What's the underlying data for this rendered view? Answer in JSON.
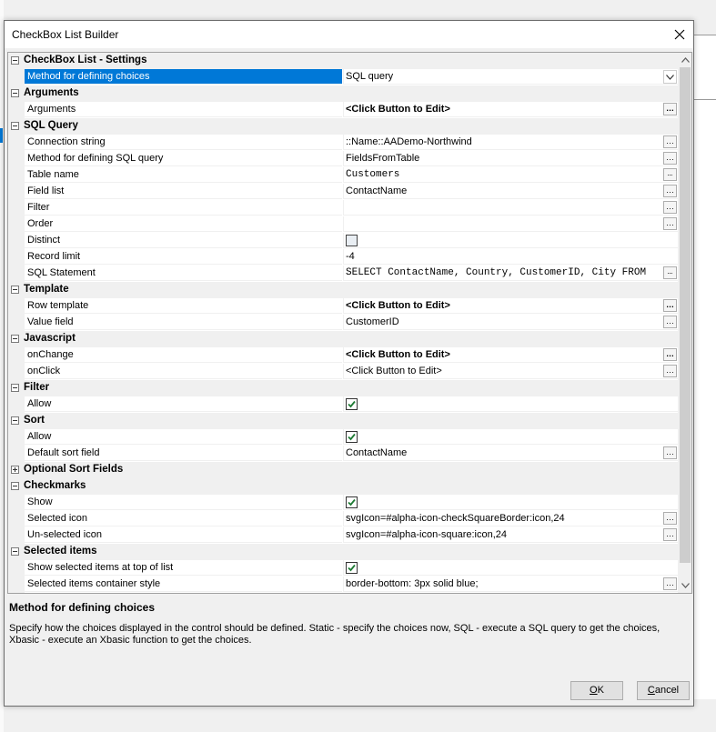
{
  "window": {
    "title": "CheckBox List Builder",
    "close_icon": "close-icon"
  },
  "grid": {
    "rows": [
      {
        "type": "cat",
        "expanded": true,
        "label": "CheckBox List - Settings"
      },
      {
        "type": "prop",
        "name": "Method for defining choices",
        "value": "SQL query",
        "editor": "dropdown",
        "selected": true
      },
      {
        "type": "cat",
        "expanded": true,
        "label": "Arguments"
      },
      {
        "type": "prop",
        "name": "Arguments",
        "value": "<Click Button to Edit>",
        "editor": "ellipsis",
        "bold": true
      },
      {
        "type": "cat",
        "expanded": true,
        "label": "SQL Query"
      },
      {
        "type": "prop",
        "name": "Connection string",
        "value": "::Name::AADemo-Northwind",
        "editor": "ellipsis"
      },
      {
        "type": "prop",
        "name": "Method for defining SQL query",
        "value": "FieldsFromTable",
        "editor": "ellipsis"
      },
      {
        "type": "prop",
        "name": "Table name",
        "value": "Customers",
        "editor": "ellipsis",
        "mono": true
      },
      {
        "type": "prop",
        "name": "Field list",
        "value": "ContactName",
        "editor": "ellipsis"
      },
      {
        "type": "prop",
        "name": "Filter",
        "value": "",
        "editor": "ellipsis"
      },
      {
        "type": "prop",
        "name": "Order",
        "value": "",
        "editor": "ellipsis"
      },
      {
        "type": "prop",
        "name": "Distinct",
        "editor": "checkbox",
        "checked": false
      },
      {
        "type": "prop",
        "name": "Record limit",
        "value": "-4"
      },
      {
        "type": "prop",
        "name": "SQL Statement",
        "value": "SELECT ContactName, Country, CustomerID, City FROM",
        "editor": "ellipsis",
        "mono": true
      },
      {
        "type": "cat",
        "expanded": true,
        "label": "Template"
      },
      {
        "type": "prop",
        "name": "Row template",
        "value": "<Click Button to Edit>",
        "editor": "ellipsis",
        "bold": true
      },
      {
        "type": "prop",
        "name": "Value field",
        "value": "CustomerID",
        "editor": "ellipsis"
      },
      {
        "type": "cat",
        "expanded": true,
        "label": "Javascript"
      },
      {
        "type": "prop",
        "name": "onChange",
        "value": "<Click Button to Edit>",
        "editor": "ellipsis",
        "bold": true
      },
      {
        "type": "prop",
        "name": "onClick",
        "value": "<Click Button to Edit>",
        "editor": "ellipsis"
      },
      {
        "type": "cat",
        "expanded": true,
        "label": "Filter"
      },
      {
        "type": "prop",
        "name": "Allow",
        "editor": "checkbox",
        "checked": true
      },
      {
        "type": "cat",
        "expanded": true,
        "label": "Sort"
      },
      {
        "type": "prop",
        "name": "Allow",
        "editor": "checkbox",
        "checked": true
      },
      {
        "type": "prop",
        "name": "Default sort field",
        "value": "ContactName",
        "editor": "ellipsis"
      },
      {
        "type": "cat",
        "expanded": false,
        "label": "Optional Sort Fields"
      },
      {
        "type": "cat",
        "expanded": true,
        "label": "Checkmarks"
      },
      {
        "type": "prop",
        "name": "Show",
        "editor": "checkbox",
        "checked": true
      },
      {
        "type": "prop",
        "name": "Selected icon",
        "value": "svgIcon=#alpha-icon-checkSquareBorder:icon,24",
        "editor": "ellipsis"
      },
      {
        "type": "prop",
        "name": "Un-selected icon",
        "value": "svgIcon=#alpha-icon-square:icon,24",
        "editor": "ellipsis"
      },
      {
        "type": "cat",
        "expanded": true,
        "label": "Selected items"
      },
      {
        "type": "prop",
        "name": "Show selected items at top of list",
        "editor": "checkbox",
        "checked": true
      },
      {
        "type": "prop",
        "name": "Selected items container style",
        "value": "border-bottom: 3px solid blue;",
        "editor": "ellipsis"
      }
    ]
  },
  "description": {
    "title": "Method for defining choices",
    "body": "Specify how the choices displayed in the control should be defined. Static - specify the choices now, SQL - execute a SQL query to get the choices, Xbasic - execute an Xbasic function to get the choices."
  },
  "buttons": {
    "ok_pre": "",
    "ok_accel": "O",
    "ok_post": "K",
    "cancel_pre": "",
    "cancel_accel": "C",
    "cancel_post": "ancel"
  },
  "colors": {
    "selection": "#0078d7",
    "category_bg": "#f0f0f0",
    "checkmark": "#1e7b34"
  }
}
